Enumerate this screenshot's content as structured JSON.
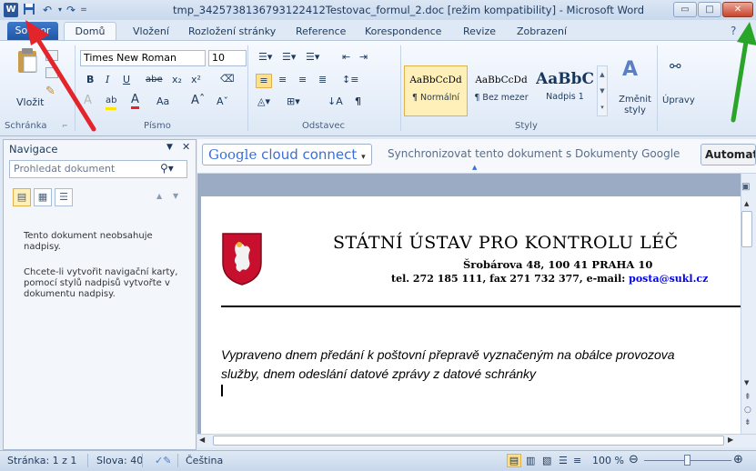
{
  "window": {
    "title": "tmp_3425738136793122412Testovac_formul_2.doc [režim kompatibility] - Microsoft Word",
    "app_icon_letter": "W",
    "min_glyph": "▭",
    "max_glyph": "□",
    "close_glyph": "✕"
  },
  "tabs": {
    "file": "Soubor",
    "items": [
      "Domů",
      "Vložení",
      "Rozložení stránky",
      "Reference",
      "Korespondence",
      "Revize",
      "Zobrazení"
    ]
  },
  "ribbon": {
    "clipboard": {
      "paste": "Vložit",
      "label": "Schránka"
    },
    "font": {
      "name": "Times New Roman",
      "size": "10",
      "label": "Písmo"
    },
    "paragraph": {
      "label": "Odstavec"
    },
    "styles": {
      "items": [
        {
          "sample": "AaBbCcDd",
          "name": "¶ Normální"
        },
        {
          "sample": "AaBbCcDd",
          "name": "¶ Bez mezer"
        },
        {
          "sample": "AaBbC",
          "name": "Nadpis 1"
        }
      ],
      "change": "Změnit styly",
      "label": "Styly"
    },
    "editing": {
      "label": "Úpravy"
    }
  },
  "nav": {
    "title": "Navigace",
    "search_placeholder": "Prohledat dokument",
    "msg1": "Tento dokument neobsahuje nadpisy.",
    "msg2": "Chcete-li vytvořit navigační karty, pomocí stylů nadpisů vytvořte v dokumentu nadpisy."
  },
  "google_bar": {
    "google": "Google",
    "cloud_connect": "cloud connect",
    "sync": "Synchronizovat tento dokument s Dokumenty Google",
    "auto": "Automat"
  },
  "document": {
    "heading": "STÁTNÍ ÚSTAV PRO KONTROLU LÉČ",
    "address": "Šrobárova 48, 100 41 PRAHA 10",
    "contact_prefix": "tel. 272 185 111, fax 271 732 377, e-mail: ",
    "email": "posta@sukl.cz",
    "body_line1": "Vypraveno dnem předání k poštovní přepravě vyznačeným na obálce provozova",
    "body_line2": "služby, dnem odeslání datové zprávy z datové schránky"
  },
  "status": {
    "page": "Stránka: 1 z 1",
    "words": "Slova: 40",
    "language": "Čeština",
    "zoom": "100 %"
  },
  "colors": {
    "accent": "#1f56a8",
    "arrow_red": "#e3242b",
    "arrow_green": "#2aa52a",
    "link": "#0000ee"
  }
}
